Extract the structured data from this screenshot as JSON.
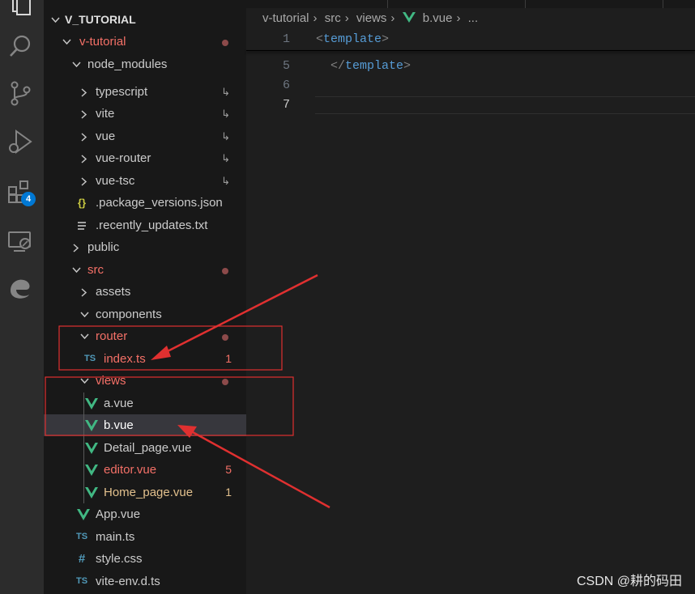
{
  "activity_bar": {
    "items": [
      {
        "name": "explorer-icon"
      },
      {
        "name": "search-icon"
      },
      {
        "name": "source-control-icon"
      },
      {
        "name": "run-debug-icon"
      },
      {
        "name": "extensions-icon"
      },
      {
        "name": "remote-explorer-icon"
      },
      {
        "name": "edge-devtools-icon"
      }
    ],
    "extensions_badge": "4"
  },
  "explorer": {
    "root_label": "V_TUTORIAL",
    "tree": [
      {
        "label": "v-tutorial",
        "kind": "folder-open",
        "status": "modified"
      },
      {
        "label": "node_modules",
        "kind": "folder-open"
      },
      {
        "label": "typescript",
        "kind": "folder",
        "link": "↳"
      },
      {
        "label": "vite",
        "kind": "folder",
        "link": "↳"
      },
      {
        "label": "vue",
        "kind": "folder",
        "link": "↳"
      },
      {
        "label": "vue-router",
        "kind": "folder",
        "link": "↳"
      },
      {
        "label": "vue-tsc",
        "kind": "folder",
        "link": "↳"
      },
      {
        "label": ".package_versions.json",
        "kind": "json"
      },
      {
        "label": ".recently_updates.txt",
        "kind": "txt"
      },
      {
        "label": "public",
        "kind": "folder"
      },
      {
        "label": "src",
        "kind": "folder-open",
        "status": "modified"
      },
      {
        "label": "assets",
        "kind": "folder"
      },
      {
        "label": "components",
        "kind": "folder-open"
      },
      {
        "label": "router",
        "kind": "folder-open",
        "status": "modified"
      },
      {
        "label": "index.ts",
        "kind": "ts",
        "status": "error",
        "count": "1"
      },
      {
        "label": "views",
        "kind": "folder-open",
        "status": "modified"
      },
      {
        "label": "a.vue",
        "kind": "vue"
      },
      {
        "label": "b.vue",
        "kind": "vue",
        "selected": true
      },
      {
        "label": "Detail_page.vue",
        "kind": "vue"
      },
      {
        "label": "editor.vue",
        "kind": "vue",
        "status": "error",
        "count": "5"
      },
      {
        "label": "Home_page.vue",
        "kind": "vue",
        "status": "warning",
        "count": "1"
      },
      {
        "label": "App.vue",
        "kind": "vue"
      },
      {
        "label": "main.ts",
        "kind": "ts"
      },
      {
        "label": "style.css",
        "kind": "css"
      },
      {
        "label": "vite-env.d.ts",
        "kind": "ts"
      }
    ],
    "icons": {
      "ts": "TS",
      "json": "{}",
      "css": "#"
    }
  },
  "editor": {
    "breadcrumb": [
      "v-tutorial",
      "src",
      "views",
      "b.vue",
      "..."
    ],
    "lines": [
      {
        "number": "1",
        "text_open": "<",
        "tag": "template",
        "text_close": ">"
      },
      {
        "number": "5",
        "text_open": "</",
        "tag": "template",
        "text_close": ">"
      },
      {
        "number": "6"
      },
      {
        "number": "7",
        "current": true
      }
    ]
  },
  "watermark": "CSDN @耕的码田",
  "colors": {
    "activity_bg": "#2c2c2c",
    "sidebar_bg": "#181818",
    "editor_bg": "#1e1e1e",
    "modified_red": "#f47067",
    "warning_yellow": "#d7ba7d",
    "vue_green": "#41b883",
    "ts_blue": "#519aba",
    "annotation_red": "#e03030"
  }
}
